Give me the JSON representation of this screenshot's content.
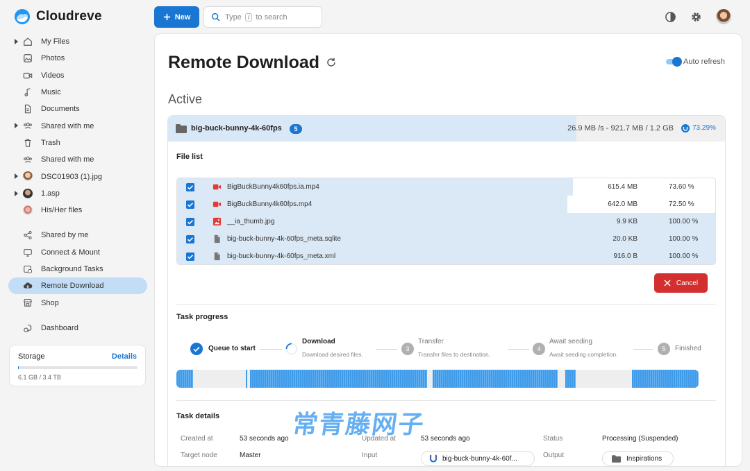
{
  "app": {
    "name": "Cloudreve"
  },
  "sidebar": {
    "items": [
      {
        "label": "My Files",
        "icon": "home-icon",
        "caret": true
      },
      {
        "label": "Photos",
        "icon": "image-icon"
      },
      {
        "label": "Videos",
        "icon": "video-icon"
      },
      {
        "label": "Music",
        "icon": "music-icon"
      },
      {
        "label": "Documents",
        "icon": "document-icon"
      },
      {
        "label": "Shared with me",
        "icon": "people-icon",
        "caret": true
      },
      {
        "label": "Trash",
        "icon": "trash-icon"
      },
      {
        "label": "Shared with me",
        "icon": "people-icon"
      },
      {
        "label": "DSC01903 (1).jpg",
        "icon": "avatar-icon",
        "caret": true
      },
      {
        "label": "1.asp",
        "icon": "avatar-icon",
        "caret": true
      },
      {
        "label": "His/Her files",
        "icon": "avatar-icon"
      },
      {
        "label": "Shared by me",
        "icon": "share-icon"
      },
      {
        "label": "Connect & Mount",
        "icon": "mount-icon"
      },
      {
        "label": "Background Tasks",
        "icon": "tasks-icon"
      },
      {
        "label": "Remote Download",
        "icon": "cloud-download-icon",
        "active": true
      },
      {
        "label": "Shop",
        "icon": "shop-icon"
      },
      {
        "label": "Dashboard",
        "icon": "dashboard-icon"
      }
    ]
  },
  "storage": {
    "title": "Storage",
    "details_label": "Details",
    "usage": "6.1 GB / 3.4 TB",
    "used_fraction": 0.002
  },
  "toolbar": {
    "new_label": "New",
    "search_prefix": "Type",
    "search_key": "/",
    "search_suffix": "to search"
  },
  "page": {
    "title": "Remote Download",
    "auto_refresh_label": "Auto refresh",
    "auto_refresh_on": true,
    "section_active": "Active"
  },
  "task": {
    "name": "big-buck-bunny-4k-60fps",
    "file_count": "5",
    "speed_summary": "26.9 MB /s - 921.7 MB / 1.2 GB",
    "progress_label": "73.29%",
    "progress_fraction": 0.7329,
    "file_list_title": "File list",
    "files": [
      {
        "name": "BigBuckBunny4k60fps.ia.mp4",
        "size": "615.4 MB",
        "progress": "73.60 %",
        "fraction": 0.736,
        "type": "video-file-icon"
      },
      {
        "name": "BigBuckBunny4k60fps.mp4",
        "size": "642.0 MB",
        "progress": "72.50 %",
        "fraction": 0.725,
        "type": "video-file-icon"
      },
      {
        "name": "__ia_thumb.jpg",
        "size": "9.9 KB",
        "progress": "100.00 %",
        "fraction": 1.0,
        "type": "image-file-icon"
      },
      {
        "name": "big-buck-bunny-4k-60fps_meta.sqlite",
        "size": "20.0 KB",
        "progress": "100.00 %",
        "fraction": 1.0,
        "type": "generic-file-icon"
      },
      {
        "name": "big-buck-bunny-4k-60fps_meta.xml",
        "size": "916.0 B",
        "progress": "100.00 %",
        "fraction": 1.0,
        "type": "generic-file-icon"
      }
    ],
    "cancel_label": "Cancel",
    "progress_title": "Task progress",
    "steps": [
      {
        "label": "Queue to start",
        "sub": "",
        "state": "done"
      },
      {
        "label": "Download",
        "sub": "Download desired files.",
        "state": "active"
      },
      {
        "num": "3",
        "label": "Transfer",
        "sub": "Transfer files to destination.",
        "state": "pending"
      },
      {
        "num": "4",
        "label": "Await seeding",
        "sub": "Await seeding completion.",
        "state": "pending"
      },
      {
        "num": "5",
        "label": "Finished",
        "sub": "",
        "state": "pending"
      }
    ],
    "details_title": "Task details",
    "details": {
      "created_label": "Created at",
      "created_value": "53 seconds ago",
      "updated_label": "Updated at",
      "updated_value": "53 seconds ago",
      "status_label": "Status",
      "status_value": "Processing (Suspended)",
      "node_label": "Target node",
      "node_value": "Master",
      "input_label": "Input",
      "input_value": "big-buck-bunny-4k-60f...",
      "output_label": "Output",
      "output_value": "Inspirations"
    }
  },
  "watermark": "常青藤网子",
  "colors": {
    "accent": "#1976d2",
    "danger": "#d32f2f",
    "active_nav": "#c3ddf6"
  }
}
